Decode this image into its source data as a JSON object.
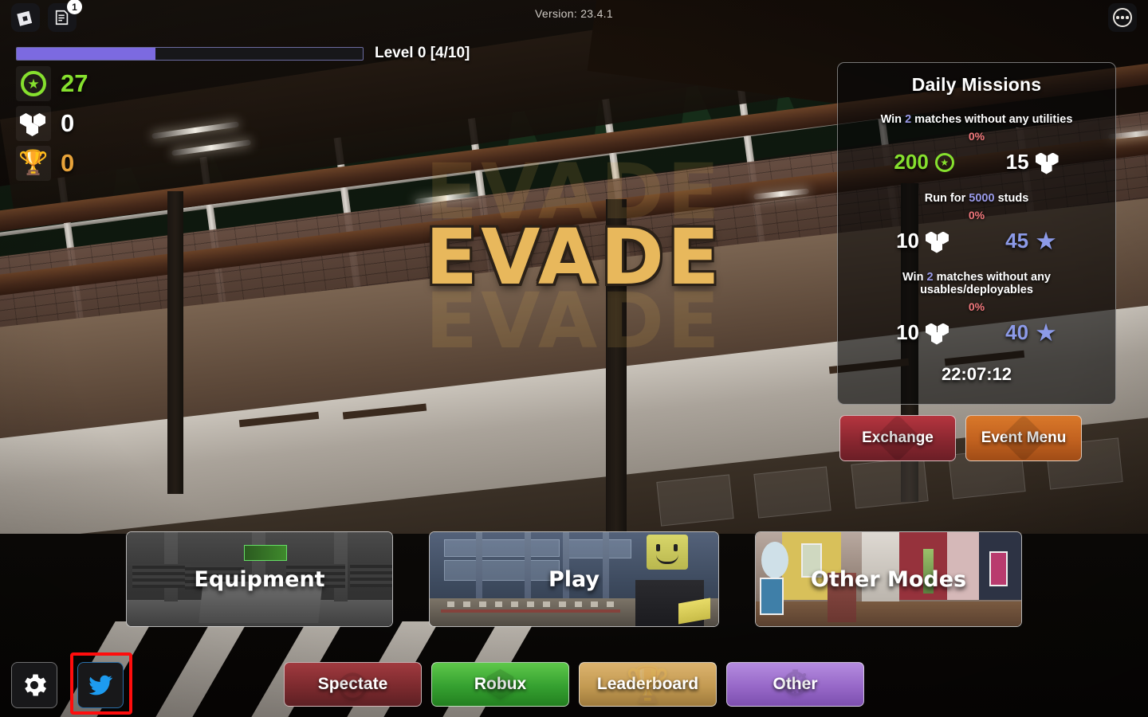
{
  "topbar": {
    "roblox_logo": "roblox-logo-icon",
    "chat_icon": "chat-notes-icon",
    "chat_badge": "1",
    "version": "Version: 23.4.1",
    "more_icon": "more-options-icon"
  },
  "level": {
    "progress_label": "Level 0 [4/10]",
    "progress_percent": 40,
    "bar_color": "#7c6ae0"
  },
  "stats": [
    {
      "icon": "green-star-coin-icon",
      "value": "27",
      "color": "#86e02e"
    },
    {
      "icon": "white-hexagon-cluster-icon",
      "value": "0",
      "color": "#ffffff"
    },
    {
      "icon": "orange-trophy-icon",
      "value": "0",
      "color": "#e8a33a"
    }
  ],
  "logo": {
    "text": "EVADE",
    "color": "#e8b85c"
  },
  "missions": {
    "title": "Daily Missions",
    "items": [
      {
        "desc_pre": "Win ",
        "desc_hl": "2",
        "desc_post": " matches without any utilities",
        "percent": "0%",
        "reward_left": "200",
        "reward_left_icon": "green-star-coin-icon",
        "reward_right": "15",
        "reward_right_icon": "white-hexagon-cluster-icon"
      },
      {
        "desc_pre": "Run for ",
        "desc_hl": "5000",
        "desc_post": " studs",
        "percent": "0%",
        "reward_left": "10",
        "reward_left_icon": "white-hexagon-cluster-icon",
        "reward_right": "45",
        "reward_right_icon": "blue-star-icon"
      },
      {
        "desc_pre": "Win ",
        "desc_hl": "2",
        "desc_post": " matches without any usables/deployables",
        "percent": "0%",
        "reward_left": "10",
        "reward_left_icon": "white-hexagon-cluster-icon",
        "reward_right": "40",
        "reward_right_icon": "blue-star-icon"
      }
    ],
    "timer": "22:07:12"
  },
  "side_buttons": [
    {
      "label": "Exchange",
      "color": "#8a2730"
    },
    {
      "label": "Event Menu",
      "color": "#c1611f"
    }
  ],
  "cards": [
    {
      "label": "Equipment"
    },
    {
      "label": "Play"
    },
    {
      "label": "Other Modes"
    }
  ],
  "bottom": {
    "settings_icon": "gear-icon",
    "twitter_icon": "twitter-bird-icon",
    "twitter_selected": true,
    "pills": [
      {
        "label": "Spectate",
        "color": "#7c2a2e"
      },
      {
        "label": "Robux",
        "color": "#35a030"
      },
      {
        "label": "Leaderboard",
        "color": "#c39a52"
      },
      {
        "label": "Other",
        "color": "#9768c8"
      }
    ]
  }
}
